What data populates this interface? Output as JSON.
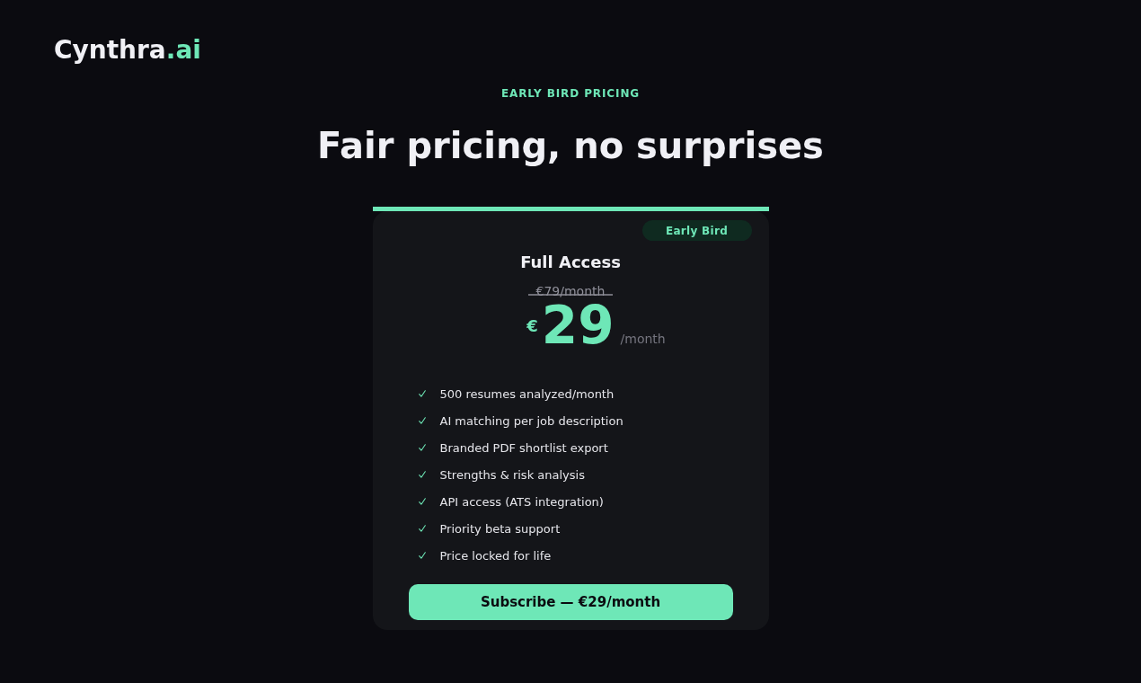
{
  "brand": {
    "name": "Cynthra",
    "suffix": ".ai"
  },
  "eyebrow": "EARLY BIRD PRICING",
  "heading": "Fair pricing, no surprises",
  "plan": {
    "badge": "Early Bird",
    "name": "Full Access",
    "old_price": "€79/month",
    "currency": "€",
    "price": "29",
    "period": "/month",
    "features": [
      "500 resumes analyzed/month",
      "AI matching per job description",
      "Branded PDF shortlist export",
      "Strengths & risk analysis",
      "API access (ATS integration)",
      "Priority beta support",
      "Price locked for life"
    ],
    "cta": "Subscribe — €29/month"
  }
}
